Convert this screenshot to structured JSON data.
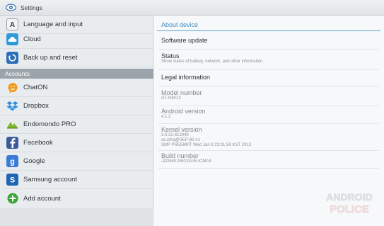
{
  "titlebar": {
    "title": "Settings",
    "icon": "settings-eye-icon"
  },
  "sidebar": {
    "items_top": [
      {
        "label": "Language and input",
        "icon": "keyboard-a-icon"
      },
      {
        "label": "Cloud",
        "icon": "cloud-icon"
      },
      {
        "label": "Back up and reset",
        "icon": "backup-reset-icon"
      }
    ],
    "section_header": "Accounts",
    "accounts": [
      {
        "label": "ChatON",
        "icon": "chaton-icon"
      },
      {
        "label": "Dropbox",
        "icon": "dropbox-icon"
      },
      {
        "label": "Endomondo PRO",
        "icon": "endomondo-icon"
      },
      {
        "label": "Facebook",
        "icon": "facebook-icon"
      },
      {
        "label": "Google",
        "icon": "google-icon"
      },
      {
        "label": "Samsung account",
        "icon": "samsung-account-icon"
      },
      {
        "label": "Add account",
        "icon": "add-icon"
      }
    ]
  },
  "main": {
    "header": "About device",
    "items": [
      {
        "title": "Software update"
      },
      {
        "title": "Status",
        "summary": "Show status of battery, network, and other information."
      },
      {
        "title": "Legal information"
      },
      {
        "title": "Model number",
        "lines": [
          "GT-N8013"
        ]
      },
      {
        "title": "Android version",
        "lines": [
          "4.1.2"
        ]
      },
      {
        "title": "Kernel version",
        "lines": [
          "3.0.31-813049",
          "se.infra@SEP-80 #1",
          "SMP PREEMPT Wed Jan 9 23:01:59 KST 2013"
        ]
      },
      {
        "title": "Build number",
        "lines": [
          "JZO54K.N8013UEUCMA3"
        ]
      }
    ]
  },
  "watermark": {
    "line1": "ANDROID",
    "line2": "POLICE"
  },
  "colors": {
    "accent": "#3b8fc6",
    "section_header_bg": "#9ca4ab",
    "titlebar_bg": "#e6e9ec"
  }
}
